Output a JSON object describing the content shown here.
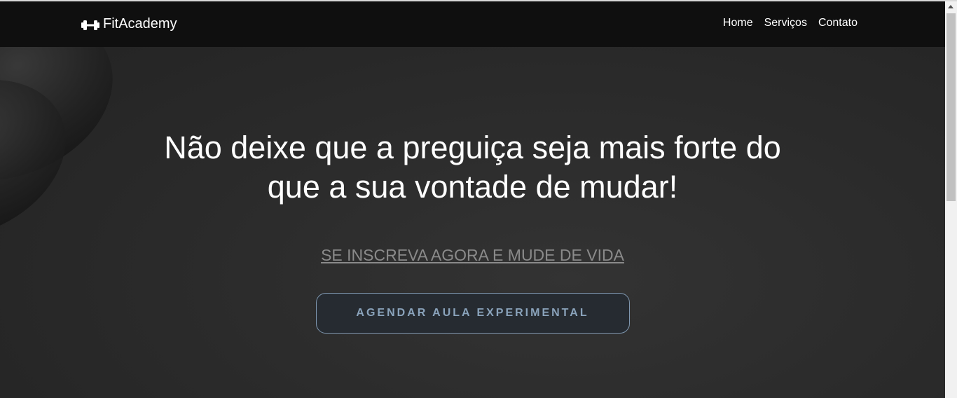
{
  "brand": {
    "name": "FitAcademy",
    "icon": "dumbbell-icon"
  },
  "nav": {
    "items": [
      {
        "label": "Home"
      },
      {
        "label": "Serviços"
      },
      {
        "label": "Contato"
      }
    ]
  },
  "hero": {
    "title": "Não deixe que a preguiça seja mais forte do que a sua vontade de mudar!",
    "signup_link": "SE INSCREVA AGORA E MUDE DE VIDA",
    "cta_button": "AGENDAR AULA EXPERIMENTAL"
  },
  "colors": {
    "navbar": "#0f0f0f",
    "background": "#2b2b2b",
    "cta_border": "#7f97b0",
    "cta_text": "#8aa3bb",
    "link": "#8a8a8a"
  }
}
